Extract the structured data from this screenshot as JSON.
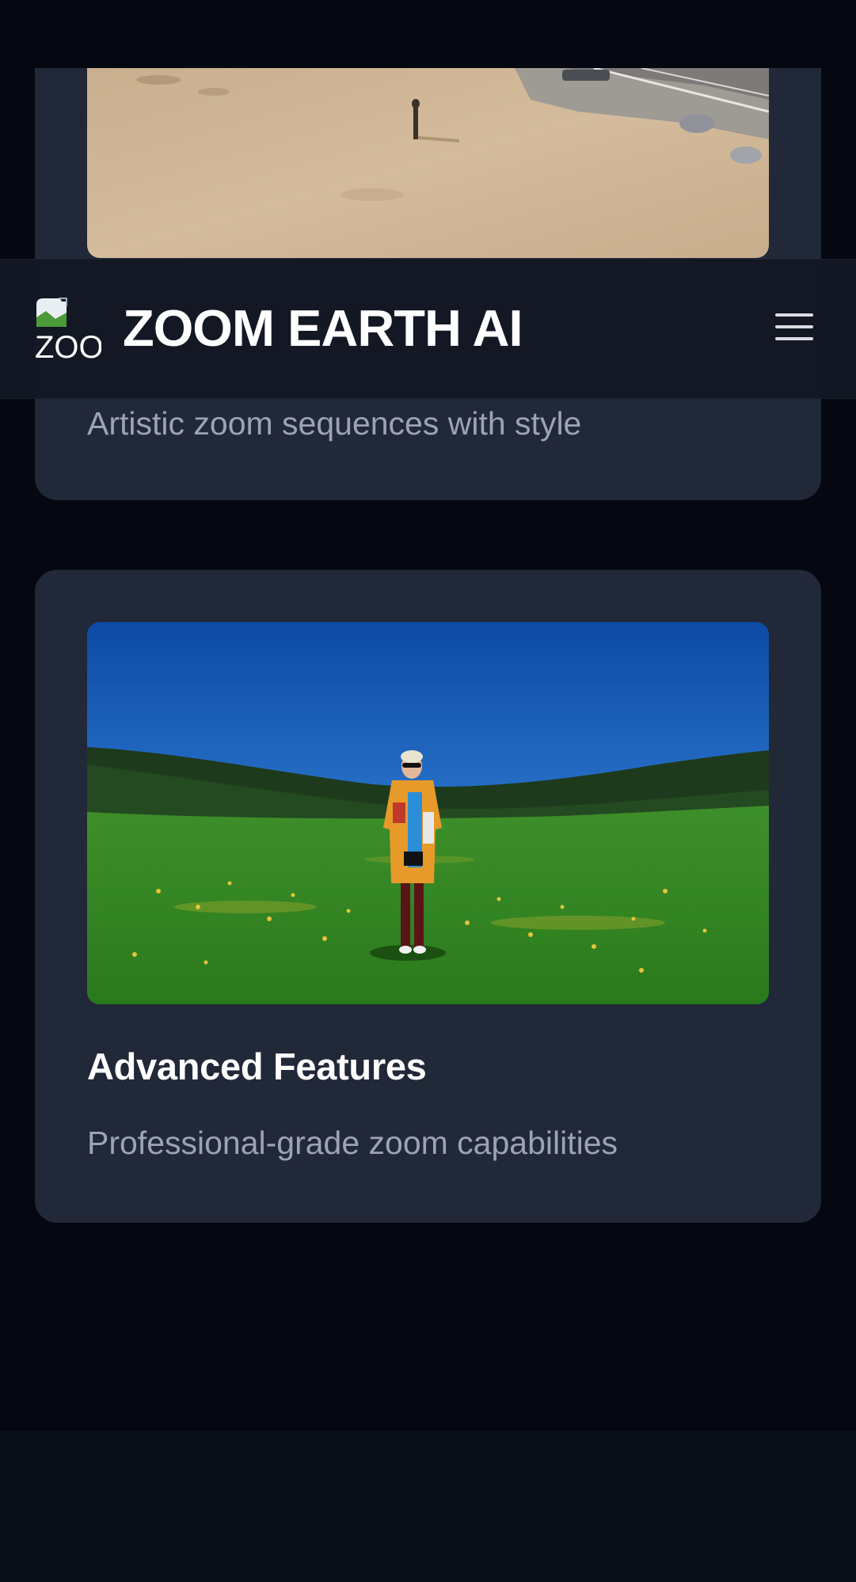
{
  "header": {
    "brand": "ZOOM EARTH AI",
    "logo_alt": "ZOOM EARTH AI",
    "menu_icon": "hamburger-menu-icon"
  },
  "cards": [
    {
      "description": "Artistic zoom sequences with style",
      "image": "aerial-desert-photo"
    },
    {
      "title": "Advanced Features",
      "description": "Professional-grade zoom capabilities",
      "image": "meadow-person-photo"
    }
  ],
  "colors": {
    "page_background": "#050811",
    "card_background": "#212838",
    "navbar_background": "#131824",
    "title_text": "#ffffff",
    "description_text": "#9ba3b4"
  }
}
